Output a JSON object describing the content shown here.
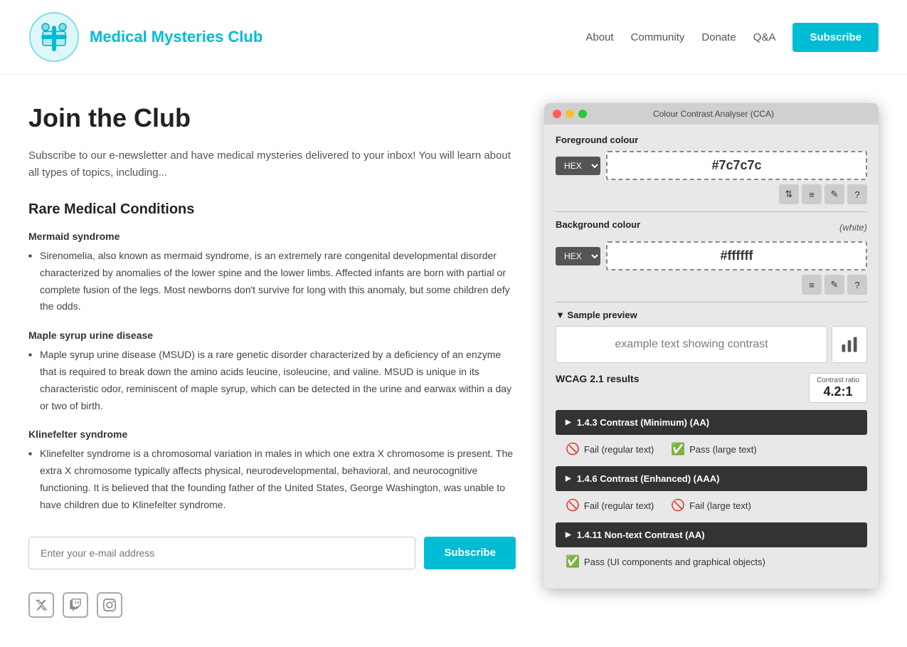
{
  "header": {
    "site_title": "Medical Mysteries Club",
    "nav_items": [
      {
        "label": "About",
        "id": "about"
      },
      {
        "label": "Community",
        "id": "community"
      },
      {
        "label": "Donate",
        "id": "donate"
      },
      {
        "label": "Q&A",
        "id": "qa"
      }
    ],
    "subscribe_label": "Subscribe"
  },
  "main": {
    "page_title": "Join the Club",
    "intro": "Subscribe to our e-newsletter and have medical mysteries delivered to your inbox! You will learn about all types of topics, including...",
    "section_title": "Rare Medical Conditions",
    "conditions": [
      {
        "title": "Mermaid syndrome",
        "description": "Sirenomelia, also known as mermaid syndrome, is an extremely rare congenital developmental disorder characterized by anomalies of the lower spine and the lower limbs. Affected infants are born with partial or complete fusion of the legs. Most newborns don't survive for long with this anomaly, but some children defy the odds."
      },
      {
        "title": "Maple syrup urine disease",
        "description": "Maple syrup urine disease (MSUD) is a rare genetic disorder characterized by a deficiency of an enzyme that is required to break down the amino acids leucine, isoleucine, and valine. MSUD is unique in its characteristic odor, reminiscent of maple syrup, which can be detected in the urine and earwax within a day or two of birth."
      },
      {
        "title": "Klinefelter syndrome",
        "description": "Klinefelter syndrome is a chromosomal variation in males in which one extra X chromosome is present. The extra X chromosome typically affects physical, neurodevelopmental, behavioral, and neurocognitive functioning. It is believed that the founding father of the United States, George Washington, was unable to have children due to Klinefelter syndrome."
      }
    ],
    "email_placeholder": "Enter your e-mail address",
    "subscribe_btn_label": "Subscribe"
  },
  "cca": {
    "title": "Colour Contrast Analyser (CCA)",
    "foreground_label": "Foreground colour",
    "fg_format": "HEX",
    "fg_value": "#7c7c7c",
    "bg_label": "Background colour",
    "bg_white_label": "(white)",
    "bg_format": "HEX",
    "bg_value": "#ffffff",
    "sample_preview_title": "▼ Sample preview",
    "sample_text": "example text showing contrast",
    "wcag_title": "WCAG 2.1 results",
    "contrast_ratio_label": "Contrast ratio",
    "contrast_ratio_value": "4.2:1",
    "criteria": [
      {
        "id": "1-4-3",
        "label": "1.4.3 Contrast (Minimum) (AA)",
        "results": [
          {
            "icon": "fail",
            "text": "Fail (regular text)"
          },
          {
            "icon": "pass",
            "text": "Pass (large text)"
          }
        ]
      },
      {
        "id": "1-4-6",
        "label": "1.4.6 Contrast (Enhanced) (AAA)",
        "results": [
          {
            "icon": "fail",
            "text": "Fail (regular text)"
          },
          {
            "icon": "fail",
            "text": "Fail (large text)"
          }
        ]
      },
      {
        "id": "1-4-11",
        "label": "1.4.11 Non-text Contrast (AA)",
        "results": [
          {
            "icon": "pass",
            "text": "Pass (UI components and graphical objects)"
          }
        ]
      }
    ]
  },
  "icons": {
    "transfer": "⇅",
    "sliders": "⚙",
    "eyedropper": "✎",
    "help": "?",
    "chart": "📊",
    "twitter": "𝕏",
    "twitch": "♟",
    "instagram": "📷"
  }
}
